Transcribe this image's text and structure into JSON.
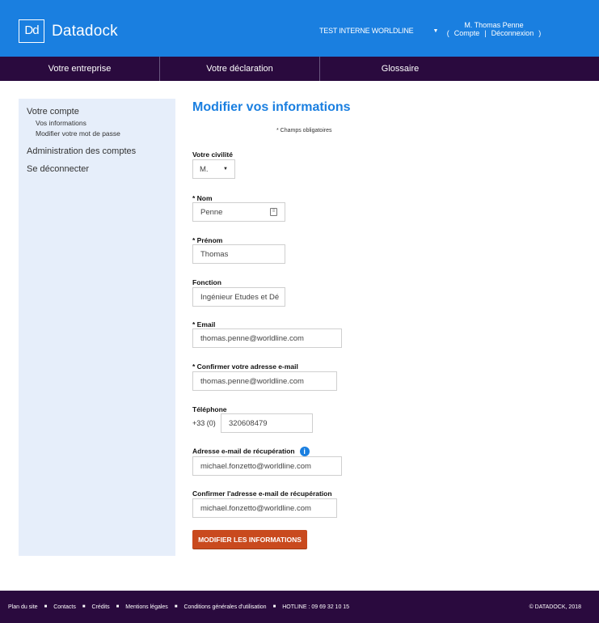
{
  "header": {
    "logo_mark": "Dd",
    "logo_text": "Datadock",
    "organization": "TEST INTERNE WORLDLINE",
    "user_name": "M. Thomas Penne",
    "account_link": "Compte",
    "logout_link": "Déconnexion"
  },
  "nav": {
    "items": [
      "Votre entreprise",
      "Votre déclaration",
      "Glossaire"
    ]
  },
  "sidebar": {
    "account": "Votre compte",
    "your_info": "Vos informations",
    "change_password": "Modifier votre mot de passe",
    "admin": "Administration des comptes",
    "logout": "Se déconnecter"
  },
  "form": {
    "title": "Modifier vos informations",
    "required_note": "* Champs obligatoires",
    "civility_label": "Votre civilité",
    "civility_value": "M.",
    "name_label": "* Nom",
    "name_value": "Penne",
    "firstname_label": "* Prénom",
    "firstname_value": "Thomas",
    "function_label": "Fonction",
    "function_value": "Ingénieur Etudes et Dé",
    "email_label": "* Email",
    "email_value": "thomas.penne@worldline.com",
    "email_confirm_label": "* Confirmer votre adresse e-mail",
    "email_confirm_value": "thomas.penne@worldline.com",
    "phone_label": "Téléphone",
    "phone_prefix": "+33 (0)",
    "phone_value": "320608479",
    "recovery_label": "Adresse e-mail de récupération",
    "recovery_value": "michael.fonzetto@worldline.com",
    "recovery_confirm_label": "Confirmer l'adresse e-mail de récupération",
    "recovery_confirm_value": "michael.fonzetto@worldline.com",
    "submit": "MODIFIER LES INFORMATIONS"
  },
  "footer": {
    "links": [
      "Plan du site",
      "Contacts",
      "Crédits",
      "Mentions légales",
      "Conditions générales d'utilisation",
      "HOTLINE : 09 69 32 10 15"
    ],
    "copyright": "© DATADOCK, 2018"
  },
  "colors": {
    "primary_blue": "#1a7fe0",
    "dark_purple": "#2a0a3e",
    "button_orange": "#c94a1e",
    "sidebar_bg": "#e6eefa"
  }
}
